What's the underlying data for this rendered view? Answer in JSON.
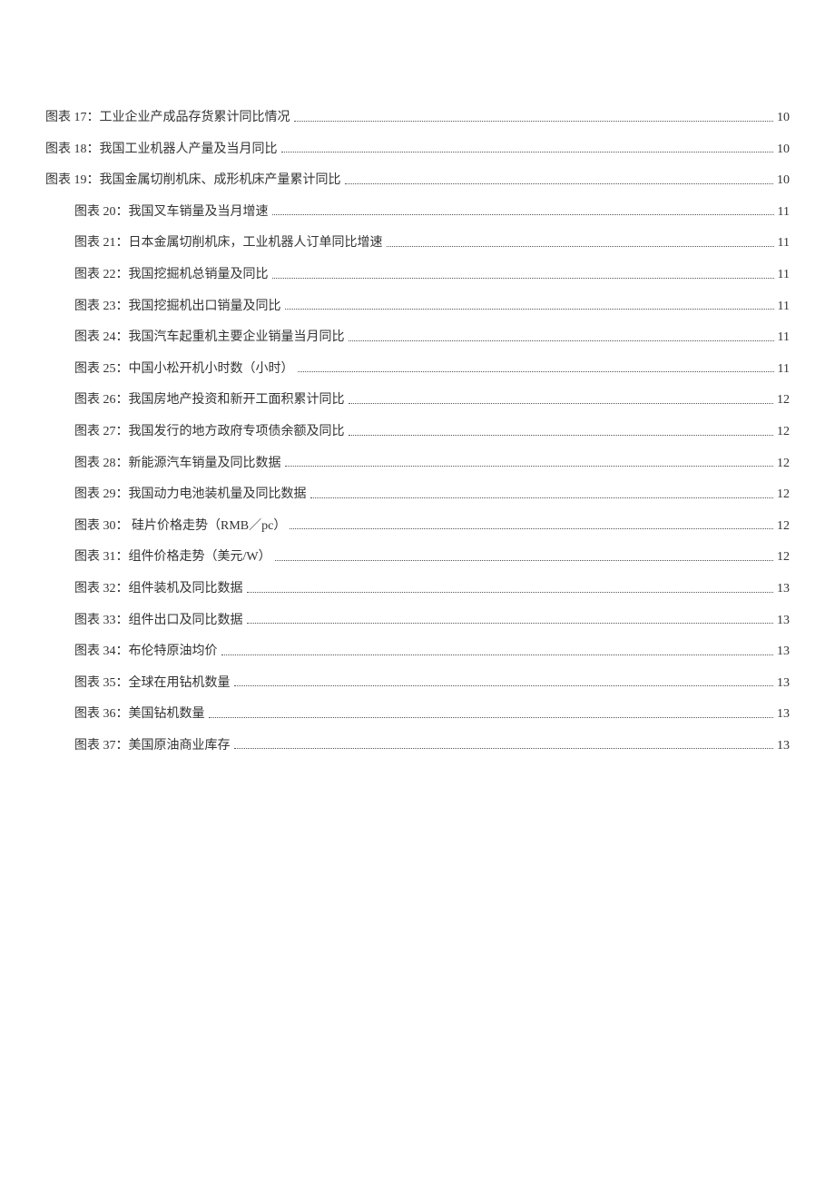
{
  "toc": {
    "entries": [
      {
        "level": 0,
        "label": "图表 17：工业企业产成品存货累计同比情况",
        "page": "10"
      },
      {
        "level": 0,
        "label": "图表 18：我国工业机器人产量及当月同比",
        "page": "10"
      },
      {
        "level": 0,
        "label": "图表 19：我国金属切削机床、成形机床产量累计同比",
        "page": "10"
      },
      {
        "level": 1,
        "label": "图表 20：我国叉车销量及当月增速",
        "page": "11"
      },
      {
        "level": 1,
        "label": "图表 21：日本金属切削机床，工业机器人订单同比增速",
        "page": "11"
      },
      {
        "level": 1,
        "label": "图表 22：我国挖掘机总销量及同比",
        "page": "11"
      },
      {
        "level": 1,
        "label": "图表 23：我国挖掘机出口销量及同比",
        "page": "11"
      },
      {
        "level": 1,
        "label": "图表 24：我国汽车起重机主要企业销量当月同比",
        "page": "11"
      },
      {
        "level": 1,
        "label": "图表 25：中国小松开机小时数（小时）",
        "page": "11"
      },
      {
        "level": 1,
        "label": "图表 26：我国房地产投资和新开工面积累计同比",
        "page": "12"
      },
      {
        "level": 1,
        "label": "图表 27：我国发行的地方政府专项债余额及同比",
        "page": "12"
      },
      {
        "level": 1,
        "label": "图表 28：新能源汽车销量及同比数据",
        "page": "12"
      },
      {
        "level": 1,
        "label": "图表 29：我国动力电池装机量及同比数据",
        "page": "12"
      },
      {
        "level": 1,
        "label": "图表 30： 硅片价格走势（RMB／pc）",
        "page": "12"
      },
      {
        "level": 1,
        "label": "图表 31：组件价格走势（美元/W）",
        "page": "12"
      },
      {
        "level": 1,
        "label": "图表 32：组件装机及同比数据",
        "page": "13"
      },
      {
        "level": 1,
        "label": "图表 33：组件出口及同比数据",
        "page": "13"
      },
      {
        "level": 1,
        "label": "图表 34：布伦特原油均价",
        "page": "13"
      },
      {
        "level": 1,
        "label": "图表 35：全球在用钻机数量",
        "page": "13"
      },
      {
        "level": 1,
        "label": "图表 36：美国钻机数量",
        "page": "13"
      },
      {
        "level": 1,
        "label": "图表 37：美国原油商业库存",
        "page": "13"
      }
    ]
  }
}
